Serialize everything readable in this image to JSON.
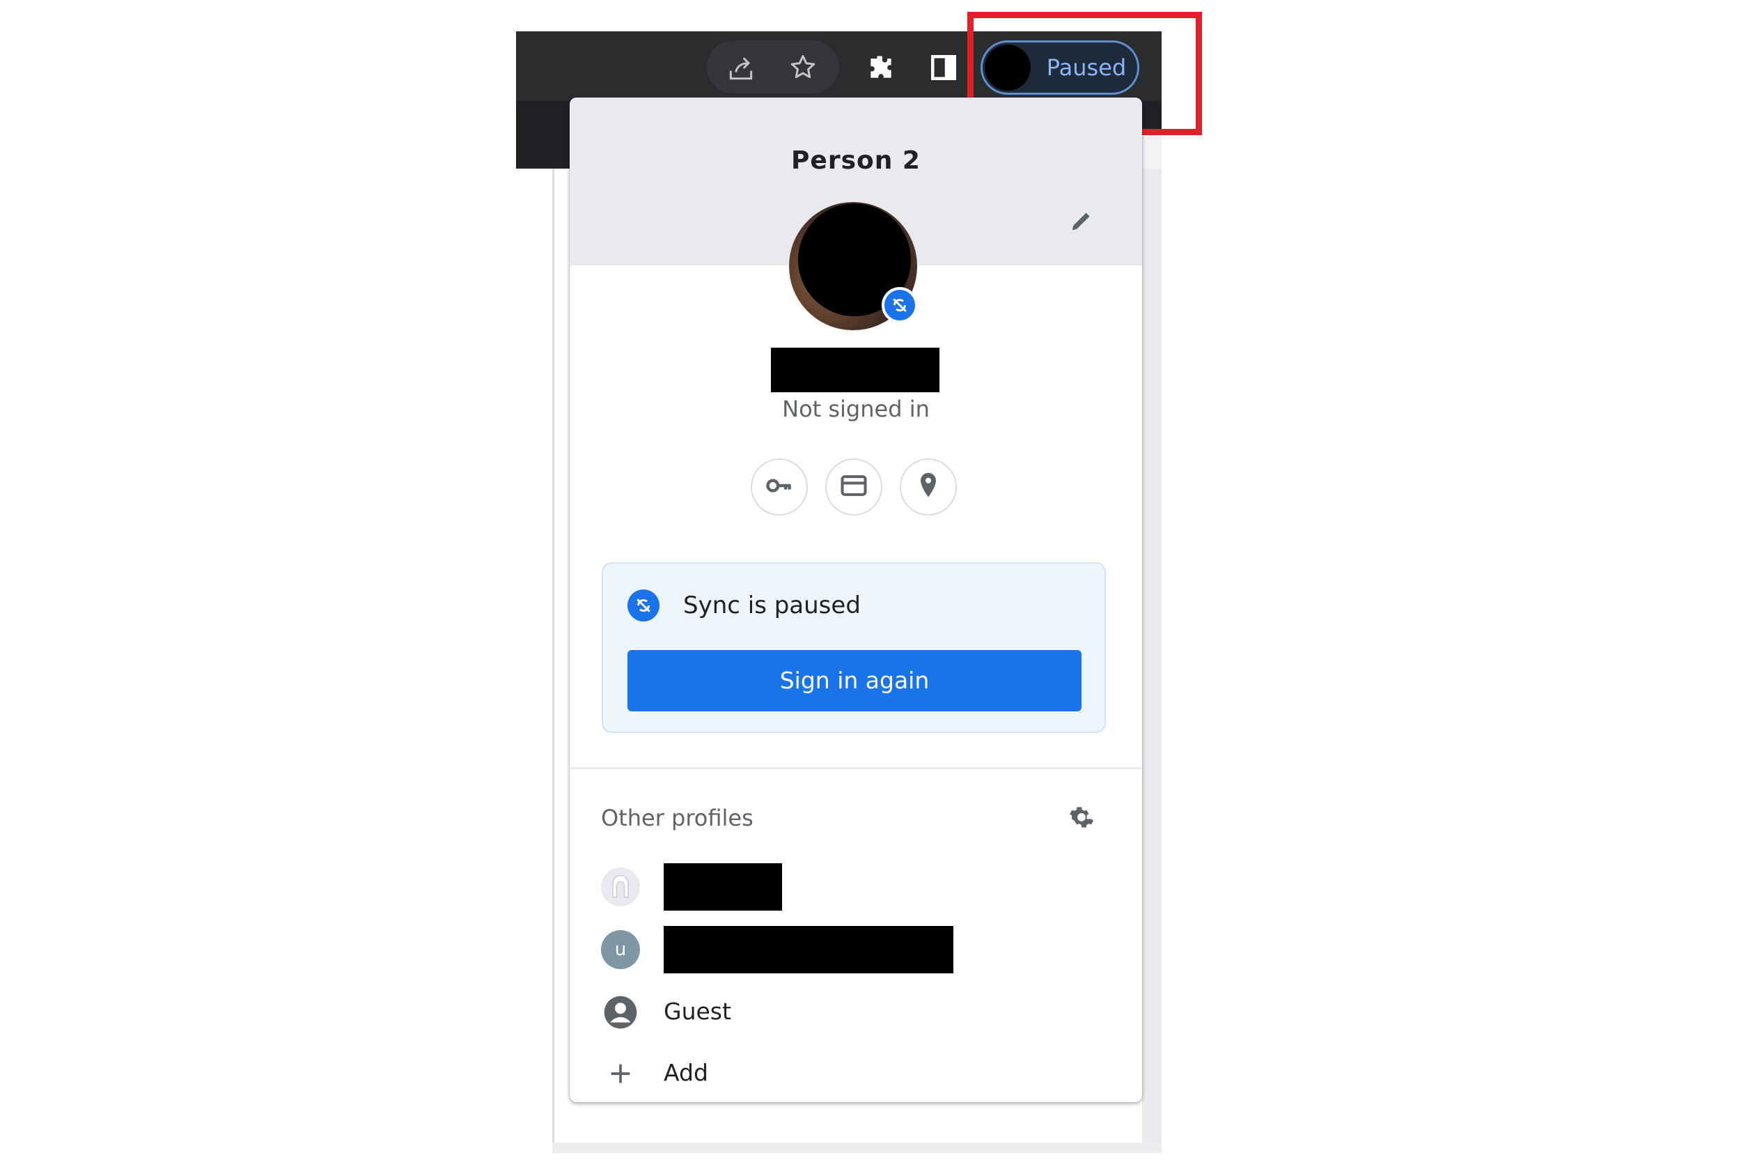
{
  "toolbar": {
    "share_icon": "share-icon",
    "bookmark_icon": "star-icon",
    "extensions_icon": "puzzle-icon",
    "side_panel_icon": "side-panel-icon",
    "profile_chip_label": "Paused"
  },
  "popup": {
    "profile_name": "Person 2",
    "status": "Not signed in",
    "quick_actions": [
      "key-icon",
      "credit-card-icon",
      "location-pin-icon"
    ],
    "sync": {
      "message": "Sync is paused",
      "button_label": "Sign in again"
    },
    "other_profiles": {
      "label": "Other profiles",
      "profiles": [
        {
          "avatar_letter": ""
        },
        {
          "avatar_letter": "u"
        },
        {
          "name": "Guest"
        }
      ],
      "add_label": "Add"
    }
  },
  "colors": {
    "accent": "#1a73e8",
    "highlight": "#e0202a",
    "toolbar": "#2b2c2e"
  }
}
